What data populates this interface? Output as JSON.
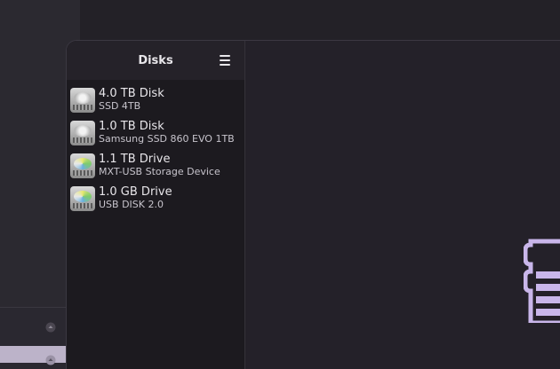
{
  "window": {
    "sidebar": {
      "title": "Disks",
      "menu_icon": "hamburger-menu-icon",
      "items": [
        {
          "name": "4.0 TB Disk",
          "subtitle": "SSD 4TB",
          "icon": "hard-disk-icon"
        },
        {
          "name": "1.0 TB Disk",
          "subtitle": "Samsung SSD 860 EVO 1TB",
          "icon": "hard-disk-icon"
        },
        {
          "name": "1.1 TB Drive",
          "subtitle": "MXT-USB Storage Device",
          "icon": "usb-drive-icon"
        },
        {
          "name": "1.0 GB Drive",
          "subtitle": "USB DISK 2.0",
          "icon": "usb-drive-icon"
        }
      ]
    },
    "main": {
      "illustration_icon": "drive-illustration-icon",
      "accent_color": "#c9b6ea"
    }
  }
}
